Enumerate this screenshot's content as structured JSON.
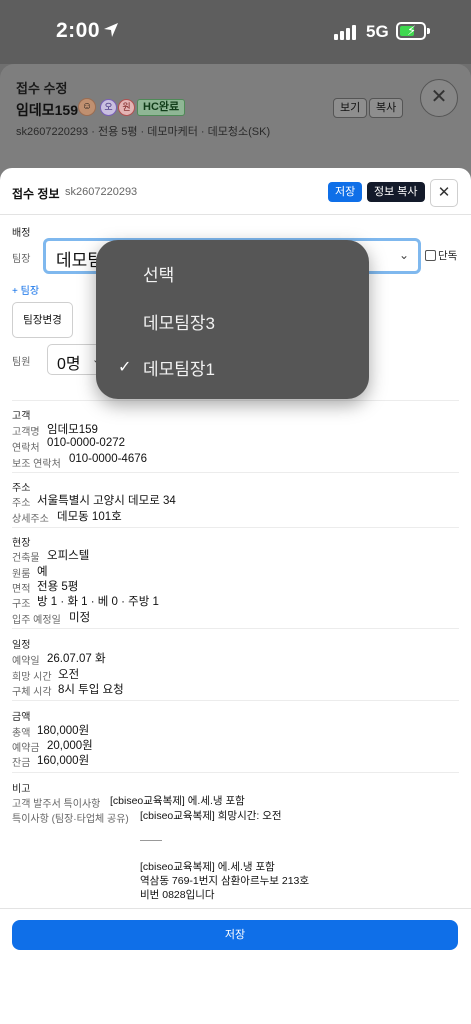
{
  "status": {
    "time": "2:00",
    "network": "5G"
  },
  "background": {
    "title": "접수 수정",
    "name": "임데모159",
    "chip_o": "오",
    "chip_won": "원",
    "hc_badge": "HC완료",
    "view_label": "보기",
    "copy_label": "복사",
    "close_label": "✕",
    "subtitle": "sk2607220293 · 전용 5평 · 데모마케터 · 데모청소(SK)"
  },
  "modal": {
    "title": "접수 정보",
    "code": "sk2607220293",
    "save_label": "저장",
    "copy_label": "정보 복사",
    "close_label": "✕",
    "assign": {
      "section": "배정",
      "leader_label": "팀장",
      "leader_value": "데모팀장1",
      "solo_label": "단독",
      "add_leader": "+ 팀장",
      "change_leader": "팀장변경",
      "member_label": "팀원",
      "member_count": "0명"
    },
    "customer": {
      "section": "고객",
      "name_label": "고객명",
      "name": "임데모159",
      "phone_label": "연락처",
      "phone": "010-0000-0272",
      "sub_phone_label": "보조 연락처",
      "sub_phone": "010-0000-4676"
    },
    "address": {
      "section": "주소",
      "addr_label": "주소",
      "addr": "서울특별시 고양시 데모로 34",
      "detail_label": "상세주소",
      "detail": "데모동 101호"
    },
    "site": {
      "section": "현장",
      "building_label": "건축물",
      "building": "오피스텔",
      "original_label": "원룸",
      "original": "예",
      "area_label": "면적",
      "area": "전용 5평",
      "structure_label": "구조",
      "structure": "방 1 · 화 1 · 베 0 · 주방 1",
      "move_label": "입주 예정일",
      "move": "미정"
    },
    "schedule": {
      "section": "일정",
      "date_label": "예약일",
      "date": "26.07.07 화",
      "wish_label": "희망 시간",
      "wish": "오전",
      "time_label": "구체 시각",
      "time": "8시 투입 요청"
    },
    "amount": {
      "section": "금액",
      "total_label": "총액",
      "total": "180,000원",
      "deposit_label": "예약금",
      "deposit": "20,000원",
      "balance_label": "잔금",
      "balance": "160,000원"
    },
    "notes": {
      "section": "비고",
      "order_label": "고객 발주서 특이사항",
      "order": "[cbiseo교육복제] 에.세.냉 포함",
      "special_label": "특이사항 (팀장·타업체 공유)",
      "special": "[cbiseo교육복제] 희망시간: 오전",
      "special_extra": "[cbiseo교육복제] 에.세.냉 포함\n역삼동 769-1번지 삼환아르누보 213호\n비번 0828입니다"
    },
    "footer_save": "저장"
  },
  "dropdown": {
    "options": [
      "선택",
      "데모팀장3",
      "데모팀장1"
    ],
    "selected": "데모팀장1",
    "check": "✓"
  }
}
